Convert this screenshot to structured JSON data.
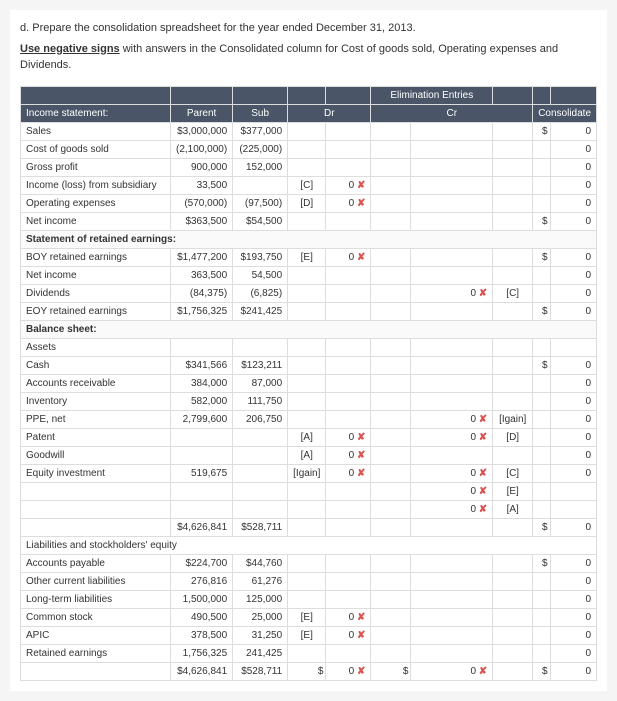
{
  "instructions": {
    "line1": "d. Prepare the consolidation spreadsheet for the year ended December 31, 2013.",
    "line2_prefix": "Use negative signs",
    "line2_rest": " with answers in the Consolidated column for Cost of goods sold, Operating expenses and Dividends."
  },
  "headers": {
    "income_stmt": "Income statement:",
    "parent": "Parent",
    "sub": "Sub",
    "elim": "Elimination Entries",
    "dr": "Dr",
    "cr": "Cr",
    "consolidated": "Consolidate"
  },
  "rows": {
    "sales": {
      "label": "Sales",
      "parent": "$3,000,000",
      "sub": "$377,000",
      "cons_sym": "$",
      "cons": "0"
    },
    "cogs": {
      "label": "Cost of goods sold",
      "parent": "(2,100,000)",
      "sub": "(225,000)",
      "cons": "0"
    },
    "gross": {
      "label": "Gross profit",
      "parent": "900,000",
      "sub": "152,000",
      "cons": "0"
    },
    "income_sub": {
      "label": "Income (loss) from subsidiary",
      "parent": "33,500",
      "dr_code": "[C]",
      "dr_val": "0",
      "wrong": "✘",
      "cons": "0"
    },
    "opex": {
      "label": "Operating expenses",
      "parent": "(570,000)",
      "sub": "(97,500)",
      "dr_code": "[D]",
      "dr_val": "0",
      "wrong": "✘",
      "cons": "0"
    },
    "netinc": {
      "label": "Net income",
      "parent": "$363,500",
      "sub": "$54,500",
      "cons_sym": "$",
      "cons": "0"
    },
    "stmt_re": {
      "label": "Statement of retained earnings:"
    },
    "boy": {
      "label": "BOY retained earnings",
      "parent": "$1,477,200",
      "sub": "$193,750",
      "dr_code": "[E]",
      "dr_val": "0",
      "wrong": "✘",
      "cons_sym": "$",
      "cons": "0"
    },
    "netinc2": {
      "label": "Net income",
      "parent": "363,500",
      "sub": "54,500",
      "cons": "0"
    },
    "div": {
      "label": "Dividends",
      "parent": "(84,375)",
      "sub": "(6,825)",
      "cr_val": "0",
      "wrong": "✘",
      "cr_code": "[C]",
      "cons": "0"
    },
    "eoy": {
      "label": "EOY retained earnings",
      "parent": "$1,756,325",
      "sub": "$241,425",
      "cons_sym": "$",
      "cons": "0"
    },
    "bs": {
      "label": "Balance sheet:"
    },
    "assets": {
      "label": "Assets"
    },
    "cash": {
      "label": "Cash",
      "parent": "$341,566",
      "sub": "$123,211",
      "cons_sym": "$",
      "cons": "0"
    },
    "ar": {
      "label": "Accounts receivable",
      "parent": "384,000",
      "sub": "87,000",
      "cons": "0"
    },
    "inv": {
      "label": "Inventory",
      "parent": "582,000",
      "sub": "111,750",
      "cons": "0"
    },
    "ppe": {
      "label": "PPE, net",
      "parent": "2,799,600",
      "sub": "206,750",
      "cr_val": "0",
      "wrong": "✘",
      "cr_code": "[Igain]",
      "cons": "0"
    },
    "patent": {
      "label": "Patent",
      "dr_code": "[A]",
      "dr_val": "0",
      "dr_wrong": "✘",
      "cr_val": "0",
      "cr_wrong": "✘",
      "cr_code": "[D]",
      "cons": "0"
    },
    "goodwill": {
      "label": "Goodwill",
      "dr_code": "[A]",
      "dr_val": "0",
      "wrong": "✘",
      "cons": "0"
    },
    "eqinv": {
      "label": "Equity investment",
      "parent": "519,675",
      "dr_code": "[Igain]",
      "dr_val": "0",
      "dr_wrong": "✘",
      "cr_val": "0",
      "cr_wrong": "✘",
      "cr_code": "[C]",
      "cons": "0"
    },
    "eqinv2": {
      "cr_val": "0",
      "wrong": "✘",
      "cr_code": "[E]"
    },
    "eqinv3": {
      "cr_val": "0",
      "wrong": "✘",
      "cr_code": "[A]"
    },
    "total_assets": {
      "parent": "$4,626,841",
      "sub": "$528,711",
      "cons_sym": "$",
      "cons": "0"
    },
    "liab": {
      "label": "Liabilities and stockholders' equity"
    },
    "ap": {
      "label": "Accounts payable",
      "parent": "$224,700",
      "sub": "$44,760",
      "cons_sym": "$",
      "cons": "0"
    },
    "ocl": {
      "label": "Other current liabilities",
      "parent": "276,816",
      "sub": "61,276",
      "cons": "0"
    },
    "ltl": {
      "label": "Long-term liabilities",
      "parent": "1,500,000",
      "sub": "125,000",
      "cons": "0"
    },
    "cs": {
      "label": "Common stock",
      "parent": "490,500",
      "sub": "25,000",
      "dr_code": "[E]",
      "dr_val": "0",
      "wrong": "✘",
      "cons": "0"
    },
    "apic": {
      "label": "APIC",
      "parent": "378,500",
      "sub": "31,250",
      "dr_code": "[E]",
      "dr_val": "0",
      "wrong": "✘",
      "cons": "0"
    },
    "re": {
      "label": "Retained earnings",
      "parent": "1,756,325",
      "sub": "241,425",
      "cons": "0"
    },
    "total_le": {
      "parent": "$4,626,841",
      "sub": "$528,711",
      "dr_sym": "$",
      "dr_val": "0",
      "dr_wrong": "✘",
      "cr_sym": "$",
      "cr_val": "0",
      "cr_wrong": "✘",
      "cons_sym": "$",
      "cons": "0"
    }
  }
}
